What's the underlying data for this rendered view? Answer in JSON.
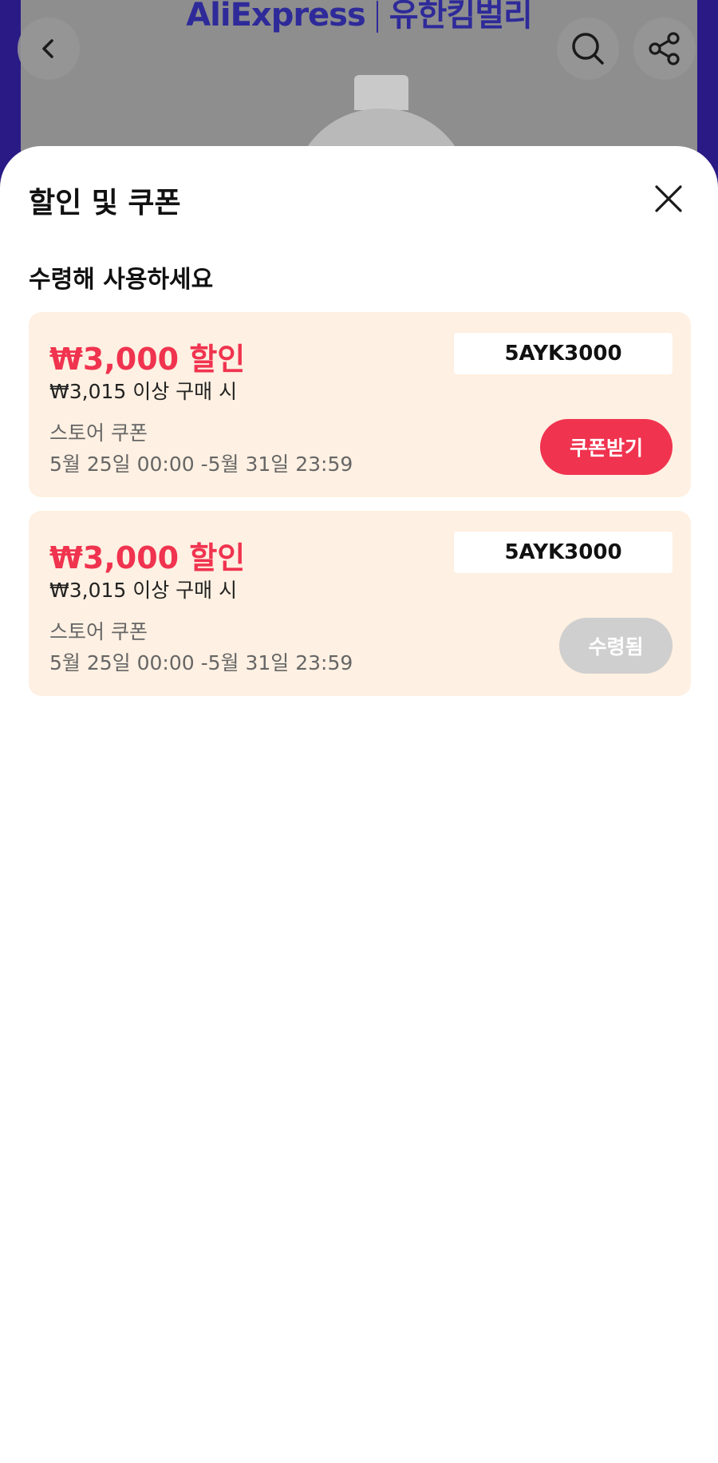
{
  "background": {
    "brand_left": "AliExpress",
    "brand_right": "유한킴벌리",
    "icons": [
      "back-icon",
      "search-icon",
      "share-icon"
    ]
  },
  "sheet": {
    "title": "할인 및 쿠폰",
    "section_title": "수령해 사용하세요",
    "coupons": [
      {
        "amount": "₩3,000 할인",
        "min_spend": "₩3,015 이상 구매 시",
        "type": "스토어 쿠폰",
        "validity": "5월 25일 00:00 -5월 31일 23:59",
        "code": "5AYK3000",
        "action_label": "쿠폰받기",
        "state": "available"
      },
      {
        "amount": "₩3,000 할인",
        "min_spend": "₩3,015 이상 구매 시",
        "type": "스토어 쿠폰",
        "validity": "5월 25일 00:00 -5월 31일 23:59",
        "code": "5AYK3000",
        "action_label": "수령됨",
        "state": "received"
      }
    ]
  },
  "colors": {
    "accent": "#f0334f",
    "coupon_bg": "#fef0e2",
    "disabled": "#cfcfcf"
  }
}
